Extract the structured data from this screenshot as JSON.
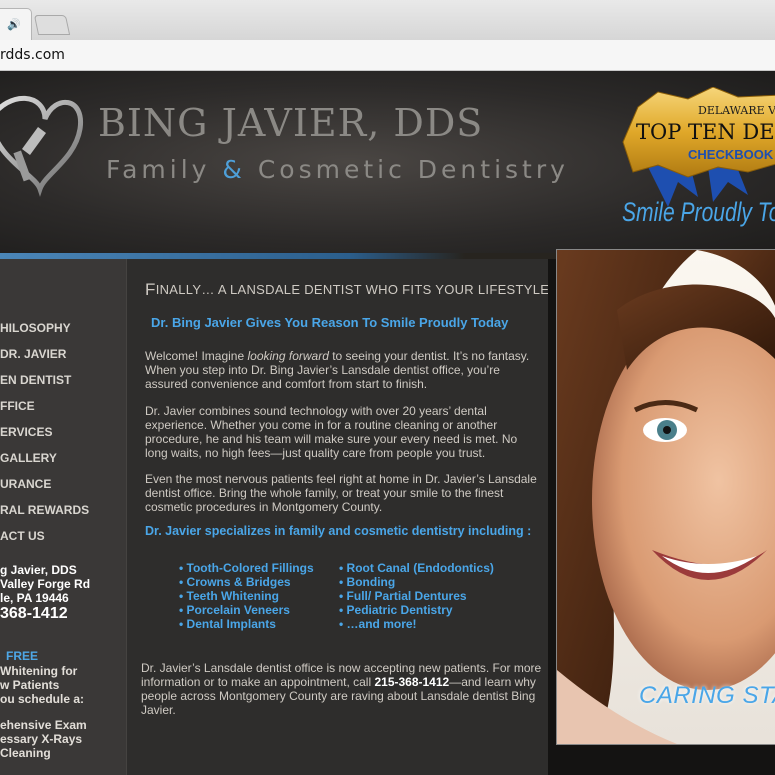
{
  "browser": {
    "url": "rdds.com"
  },
  "header": {
    "brand_name": "BING JAVIER, DDS",
    "tagline_part1": "Family ",
    "tagline_amp": "&",
    "tagline_part2": " Cosmetic Dentistry",
    "badge_line1": "DELAWARE VALL",
    "badge_line2": "TOP TEN DENT",
    "badge_line3": "CHECKBOOK",
    "slogan": "Smile Proudly Tod"
  },
  "nav": {
    "items": [
      "HILOSOPHY",
      "DR. JAVIER",
      "EN DENTIST",
      "FFICE",
      "ERVICES",
      "GALLERY",
      "URANCE",
      "RAL REWARDS",
      "ACT US"
    ],
    "address": [
      "g Javier, DDS",
      "Valley Forge Rd",
      "le, PA 19446"
    ],
    "phone": "368-1412",
    "free_label": "FREE",
    "promo_lines": [
      "Whitening for",
      "w Patients",
      "ou schedule a:"
    ],
    "promo_items": [
      "ehensive Exam",
      "essary X-Rays",
      "Cleaning"
    ]
  },
  "main": {
    "heading_first": "F",
    "heading_rest": "INALLY… A LANSDALE DENTIST WHO FITS YOUR LIFESTYLE!",
    "subhead": "Dr. Bing Javier Gives You Reason To Smile Proudly Today",
    "p1_a": "Welcome! Imagine ",
    "p1_em": "looking forward",
    "p1_b": " to seeing your dentist. It’s no fantasy. When you step into Dr. Bing Javier’s Lansdale dentist office, you’re assured convenience and comfort from start to finish.",
    "p2": "Dr. Javier combines sound technology with over 20 years’ dental experience. Whether you come in for a routine cleaning or another procedure, he and his team will make sure your every need is met. No long waits, no high fees—just quality care from people you trust.",
    "p3": "Even the most nervous patients feel right at home in Dr. Javier’s Lansdale dentist office. Bring the whole family, or treat your smile to the finest cosmetic procedures in Montgomery County.",
    "specialize": "Dr. Javier specializes in family and cosmetic dentistry including :",
    "services_left": [
      "• Tooth-Colored Fillings",
      "• Crowns & Bridges",
      "• Teeth Whitening",
      "• Porcelain Veneers",
      "• Dental Implants"
    ],
    "services_right": [
      "• Root Canal (Endodontics)",
      "• Bonding",
      "• Full/ Partial Dentures",
      "• Pediatric Dentistry",
      "• …and more!"
    ],
    "p4_a": "Dr. Javier’s Lansdale dentist office is now accepting new patients. For more information or to make an appointment, call ",
    "p4_phone": "215-368-1412",
    "p4_b": "—and learn why people across Montgomery County are raving about Lansdale dentist Bing Javier."
  },
  "photo": {
    "caption": "CARING STA"
  },
  "colors": {
    "accent": "#4aa6e8",
    "background": "#2e2d2c",
    "nav": "#3a3837"
  }
}
